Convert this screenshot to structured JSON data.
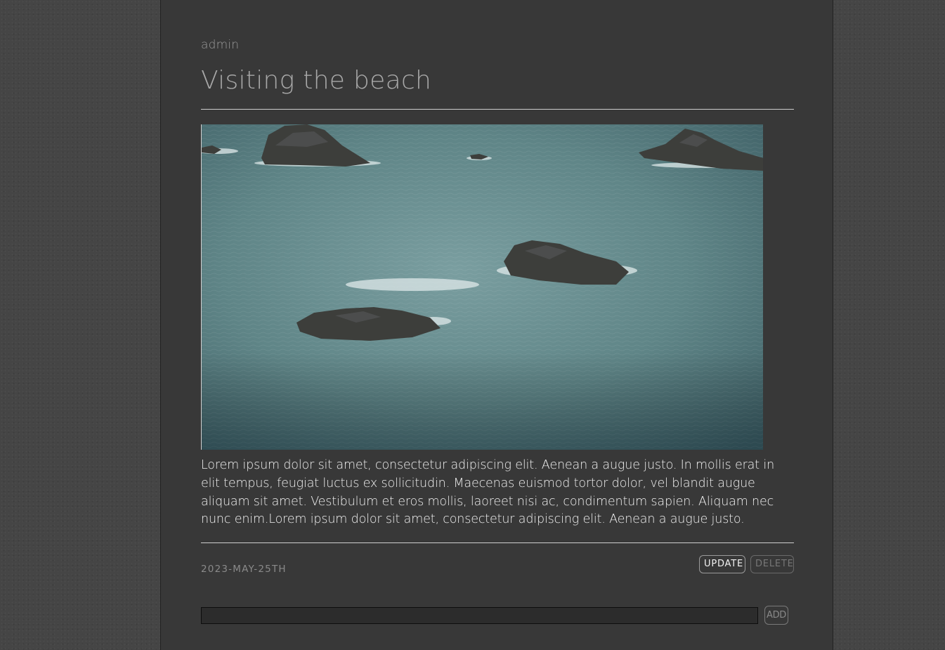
{
  "post": {
    "author": "admin",
    "title": "Visiting the beach",
    "image_alt": "Aerial view of rocks in the sea",
    "body": "Lorem ipsum dolor sit amet, consectetur adipiscing elit. Aenean a augue justo. In mollis erat in elit tempus, feugiat luctus ex sollicitudin. Maecenas euismod tortor dolor, vel blandit augue aliquam sit amet. Vestibulum et eros mollis, laoreet nisi ac, condimentum sapien. Aliquam nec nunc enim.Lorem ipsum dolor sit amet, consectetur adipiscing elit. Aenean a augue justo.",
    "date": "2023-MAY-25TH"
  },
  "actions": {
    "update_label": "UPDATE",
    "delete_label": "DELETE"
  },
  "comment": {
    "value": "",
    "placeholder": "",
    "add_label": "ADD"
  },
  "colors": {
    "page_background": "#454545",
    "card_background": "#383838",
    "sea": "#5f8588",
    "rock": "#3a3b38"
  }
}
